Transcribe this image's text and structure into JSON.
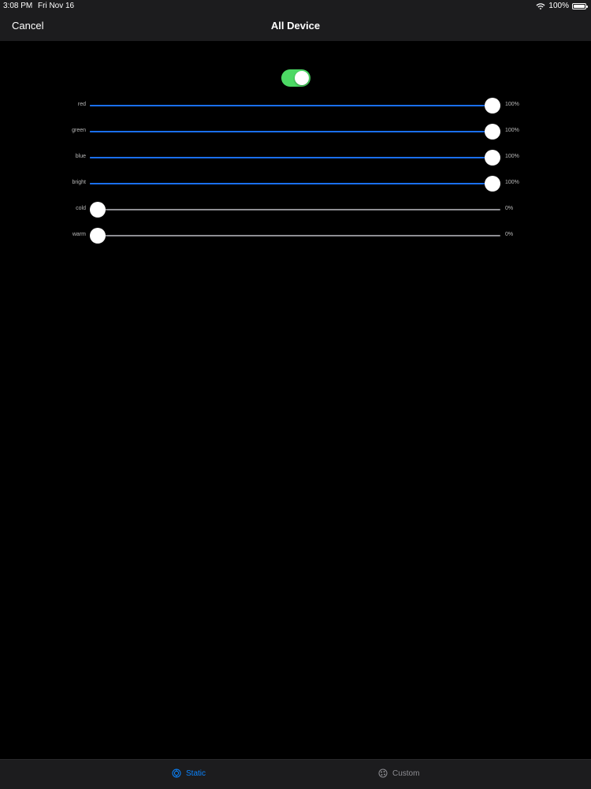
{
  "status_bar": {
    "time": "3:08 PM",
    "date": "Fri Nov 16",
    "battery": "100%"
  },
  "nav": {
    "cancel": "Cancel",
    "title": "All Device"
  },
  "power_toggle": {
    "on": true
  },
  "sliders": [
    {
      "label": "red",
      "value": 1.0,
      "value_text": "100%",
      "filled": true
    },
    {
      "label": "green",
      "value": 1.0,
      "value_text": "100%",
      "filled": true
    },
    {
      "label": "blue",
      "value": 1.0,
      "value_text": "100%",
      "filled": true
    },
    {
      "label": "bright",
      "value": 1.0,
      "value_text": "100%",
      "filled": true
    },
    {
      "label": "cold",
      "value": 0.0,
      "value_text": "0%",
      "filled": false
    },
    {
      "label": "warm",
      "value": 0.0,
      "value_text": "0%",
      "filled": false
    }
  ],
  "tabs": [
    {
      "label": "Static",
      "icon": "static-icon",
      "selected": true
    },
    {
      "label": "Custom",
      "icon": "custom-icon",
      "selected": false
    }
  ],
  "colors": {
    "accent": "#0a84ff",
    "toggle_on": "#4cd964",
    "slider_fill": "#1a6ff0",
    "slider_track": "#8e8e93"
  }
}
